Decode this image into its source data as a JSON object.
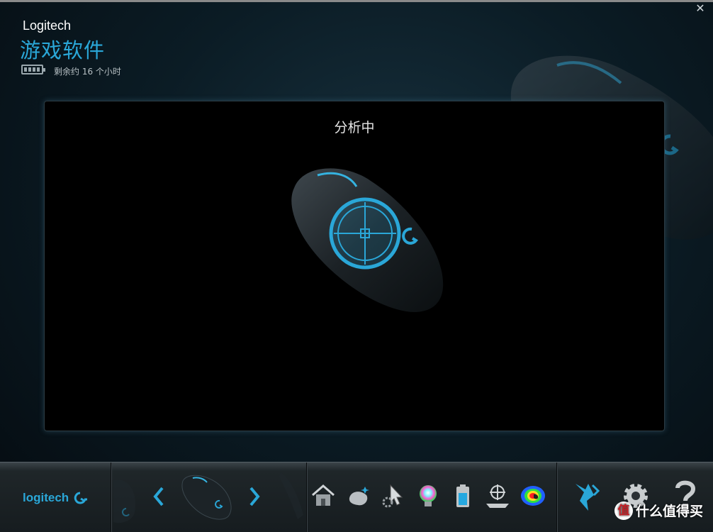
{
  "window": {
    "close_glyph": "✕"
  },
  "header": {
    "brand": "Logitech",
    "title": "游戏软件",
    "battery_text": "剩余约 16 个小时",
    "battery_icon": "battery-icon"
  },
  "panel": {
    "status": "分析中"
  },
  "bottom": {
    "logo_text": "logitech",
    "prev_icon": "chevron-left-icon",
    "next_icon": "chevron-right-icon",
    "tools": [
      "home-icon",
      "customize-buttons-icon",
      "pointer-settings-icon",
      "lighting-icon",
      "battery-status-icon",
      "surface-tuning-icon",
      "heatmap-icon"
    ],
    "right_tools": [
      "arx-control-icon",
      "settings-gear-icon",
      "help-icon"
    ],
    "accent": "#2aa7d8"
  },
  "watermark": {
    "badge": "值",
    "text": "什么值得买"
  }
}
